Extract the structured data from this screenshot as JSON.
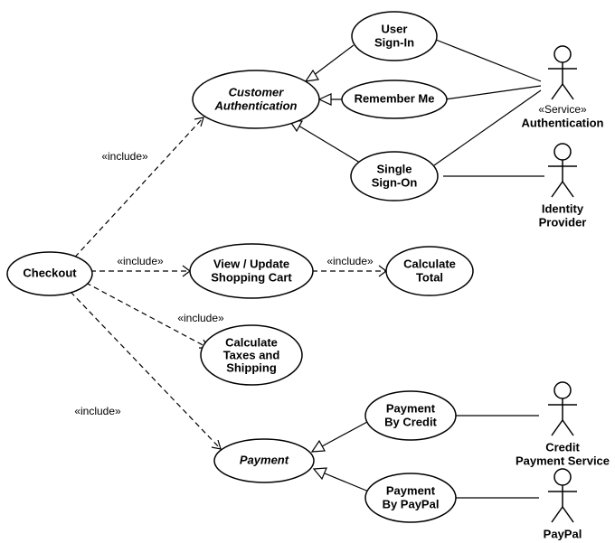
{
  "usecases": {
    "checkout": "Checkout",
    "customer_auth": {
      "l1": "Customer",
      "l2": "Authentication"
    },
    "user_signin": {
      "l1": "User",
      "l2": "Sign-In"
    },
    "remember_me": "Remember Me",
    "single_signon": {
      "l1": "Single",
      "l2": "Sign-On"
    },
    "view_update": {
      "l1": "View / Update",
      "l2": "Shopping Cart"
    },
    "calc_total": {
      "l1": "Calculate",
      "l2": "Total"
    },
    "calc_tax": {
      "l1": "Calculate",
      "l2": "Taxes and",
      "l3": "Shipping"
    },
    "payment": "Payment",
    "payment_credit": {
      "l1": "Payment",
      "l2": "By Credit"
    },
    "payment_paypal": {
      "l1": "Payment",
      "l2": "By PayPal"
    }
  },
  "actors": {
    "authentication": {
      "stereo": "«Service»",
      "name": "Authentication"
    },
    "identity_provider": {
      "l1": "Identity",
      "l2": "Provider"
    },
    "credit_payment": {
      "l1": "Credit",
      "l2": "Payment Service"
    },
    "paypal": "PayPal"
  },
  "relationships": {
    "include": "«include»"
  }
}
